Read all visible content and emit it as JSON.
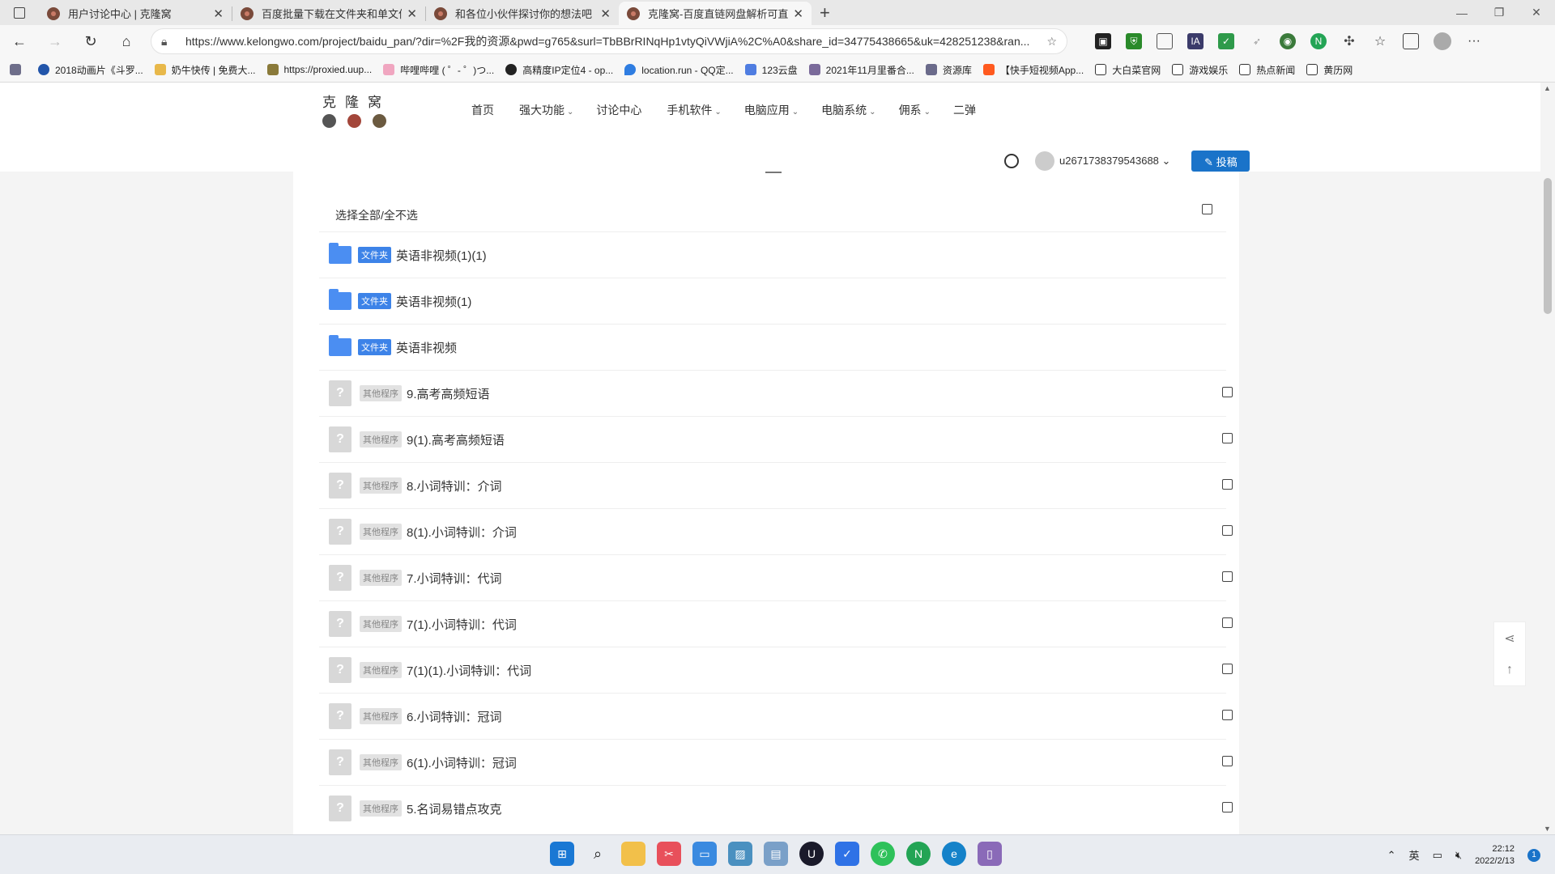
{
  "browser": {
    "tabs": [
      {
        "title": "用户讨论中心 | 克隆窝",
        "close": "✕"
      },
      {
        "title": "百度批量下载在文件夹和单文件",
        "close": "✕"
      },
      {
        "title": "和各位小伙伴探讨你的想法吧 | 克",
        "close": "✕"
      },
      {
        "title": "克隆窝-百度直链网盘解析可直接",
        "close": "✕"
      }
    ],
    "new_tab": "+",
    "window_controls": [
      "—",
      "❐",
      "✕"
    ],
    "url": "https://www.kelongwo.com/project/baidu_pan/?dir=%2F我的资源&pwd=g765&surl=TbBBrRINqHp1vtyQiVWjiA%2C%A0&share_id=34775438665&uk=428251238&ran...",
    "bookmarks": [
      {
        "label": "",
        "color": "#6e6e8a"
      },
      {
        "label": "2018动画片《斗罗...",
        "color": "#2255aa"
      },
      {
        "label": "奶牛快传 | 免费大...",
        "color": "#e8b84a"
      },
      {
        "label": "https://proxied.uup...",
        "color": "#8a7a3a"
      },
      {
        "label": "哔哩哔哩 ( ゜- ゜)つ...",
        "color": "#f0a6c0"
      },
      {
        "label": "高精度IP定位4 - op...",
        "color": "#222222"
      },
      {
        "label": "location.run - QQ定...",
        "color": "#2f7de1"
      },
      {
        "label": "123云盘",
        "color": "#4f7de1"
      },
      {
        "label": "2021年11月里番合...",
        "color": "#7a6a9a"
      },
      {
        "label": "资源库",
        "color": "#6a6a8a"
      },
      {
        "label": "【快手短视频App...",
        "color": "#ff5a1f"
      },
      {
        "label": "大白菜官网",
        "color": "#ffffff"
      },
      {
        "label": "游戏娱乐",
        "color": "#ffffff"
      },
      {
        "label": "热点新闻",
        "color": "#ffffff"
      },
      {
        "label": "黄历网",
        "color": "#ffffff"
      }
    ]
  },
  "site": {
    "logo_text": "克隆窝",
    "nav": [
      {
        "label": "首页",
        "caret": ""
      },
      {
        "label": "强大功能",
        "caret": "⌄"
      },
      {
        "label": "讨论中心",
        "caret": ""
      },
      {
        "label": "手机软件",
        "caret": "⌄"
      },
      {
        "label": "电脑应用",
        "caret": "⌄"
      },
      {
        "label": "电脑系统",
        "caret": "⌄"
      },
      {
        "label": "佣系",
        "caret": "⌄"
      },
      {
        "label": "二弹",
        "caret": ""
      }
    ],
    "username": "u2671738379543688 ⌄",
    "post_button": "✎ 投稿"
  },
  "list": {
    "select_all": "选择全部/全不选",
    "folders": [
      {
        "tag": "文件夹",
        "name": "英语非视频(1)(1)"
      },
      {
        "tag": "文件夹",
        "name": "英语非视频(1)"
      },
      {
        "tag": "文件夹",
        "name": "英语非视频"
      }
    ],
    "files": [
      {
        "tag": "其他程序",
        "icon": "?",
        "name": "9.高考高频短语"
      },
      {
        "tag": "其他程序",
        "icon": "?",
        "name": "9(1).高考高频短语"
      },
      {
        "tag": "其他程序",
        "icon": "?",
        "name": "8.小词特训：介词"
      },
      {
        "tag": "其他程序",
        "icon": "?",
        "name": "8(1).小词特训：介词"
      },
      {
        "tag": "其他程序",
        "icon": "?",
        "name": "7.小词特训：代词"
      },
      {
        "tag": "其他程序",
        "icon": "?",
        "name": "7(1).小词特训：代词"
      },
      {
        "tag": "其他程序",
        "icon": "?",
        "name": "7(1)(1).小词特训：代词"
      },
      {
        "tag": "其他程序",
        "icon": "?",
        "name": "6.小词特训：冠词"
      },
      {
        "tag": "其他程序",
        "icon": "?",
        "name": "6(1).小词特训：冠词"
      },
      {
        "tag": "其他程序",
        "icon": "?",
        "name": "5.名词易错点攻克"
      }
    ]
  },
  "taskbar": {
    "ime": "英",
    "time": "22:12",
    "date": "2022/2/13",
    "notifications": "1"
  }
}
